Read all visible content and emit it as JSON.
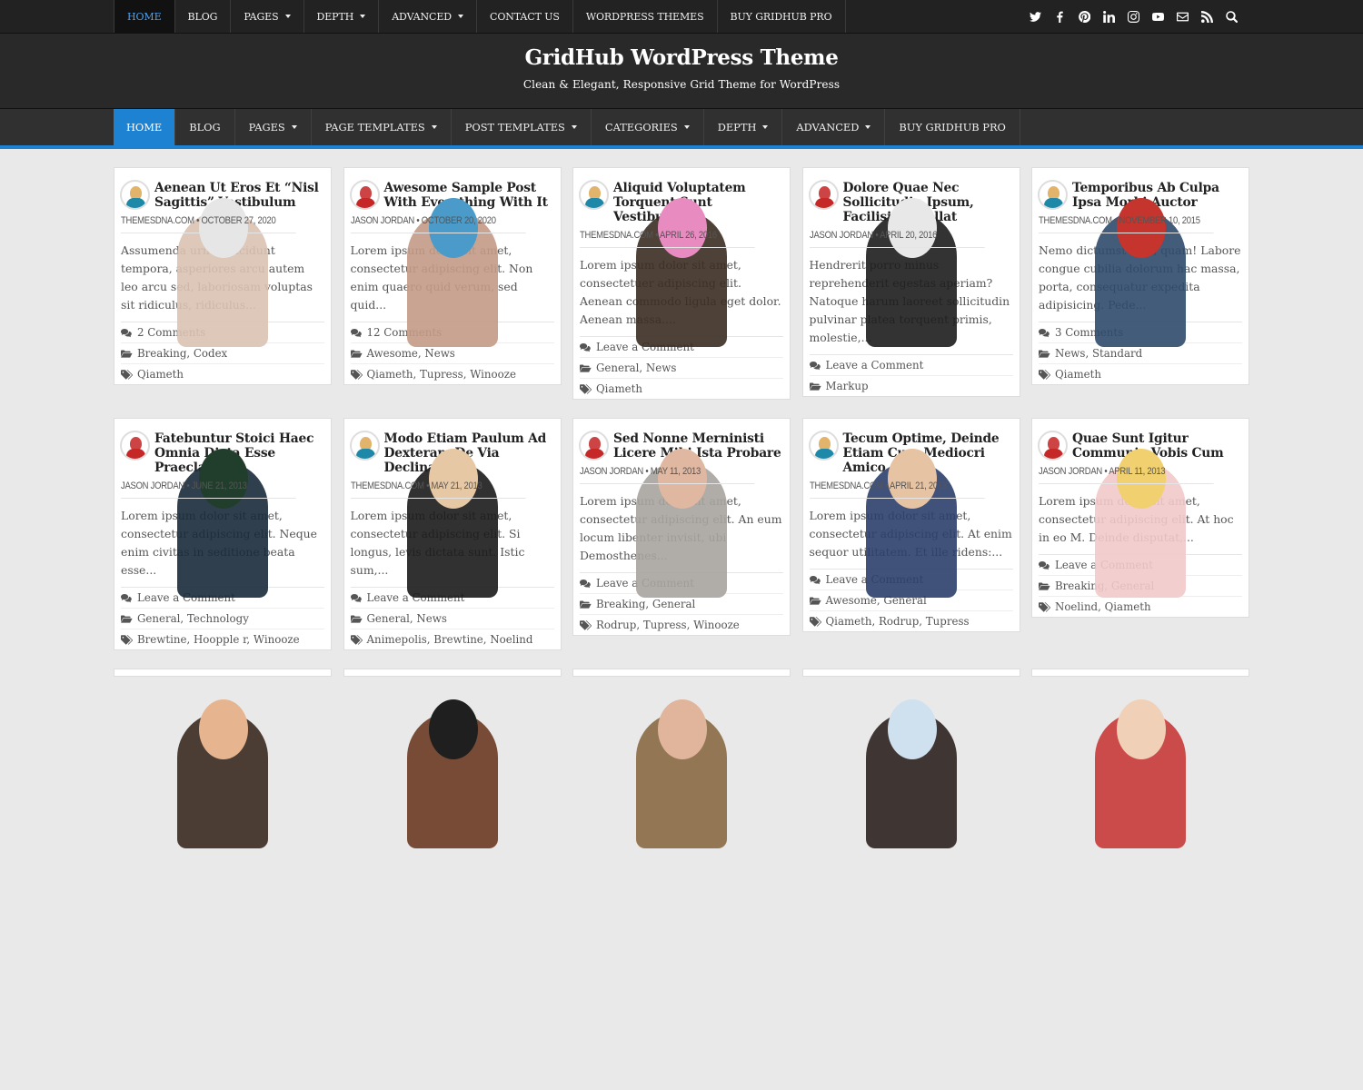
{
  "topnav": {
    "items": [
      {
        "label": "HOME",
        "dropdown": false,
        "active": true
      },
      {
        "label": "BLOG",
        "dropdown": false
      },
      {
        "label": "PAGES",
        "dropdown": true
      },
      {
        "label": "DEPTH",
        "dropdown": true
      },
      {
        "label": "ADVANCED",
        "dropdown": true
      },
      {
        "label": "CONTACT US",
        "dropdown": false
      },
      {
        "label": "WORDPRESS THEMES",
        "dropdown": false
      },
      {
        "label": "BUY GRIDHUB PRO",
        "dropdown": false
      }
    ]
  },
  "social": [
    "twitter-icon",
    "facebook-icon",
    "pinterest-icon",
    "linkedin-icon",
    "instagram-icon",
    "youtube-icon",
    "email-icon",
    "rss-icon",
    "search-icon"
  ],
  "header": {
    "title": "GridHub WordPress Theme",
    "description": "Clean & Elegant, Responsive Grid Theme for WordPress"
  },
  "mainnav": {
    "items": [
      {
        "label": "HOME",
        "dropdown": false,
        "active": true
      },
      {
        "label": "BLOG",
        "dropdown": false
      },
      {
        "label": "PAGES",
        "dropdown": true
      },
      {
        "label": "PAGE TEMPLATES",
        "dropdown": true
      },
      {
        "label": "POST TEMPLATES",
        "dropdown": true
      },
      {
        "label": "CATEGORIES",
        "dropdown": true
      },
      {
        "label": "DEPTH",
        "dropdown": true
      },
      {
        "label": "ADVANCED",
        "dropdown": true
      },
      {
        "label": "BUY GRIDHUB PRO",
        "dropdown": false
      }
    ]
  },
  "colors": {
    "accent": "#1e82d2",
    "topbar": "#222222",
    "header": "#292929",
    "mainnav": "#303030"
  },
  "posts": [
    {
      "title": "Aenean Ut Eros Et “Nisl Sagittis” Vestibulum",
      "author": "THEMESDNA.COM",
      "date": "OCTOBER 27, 2020",
      "excerpt": "Assumenda urna, tincidunt tempora, asperiores arcu autem leo arcu sed, laboriosam voluptas sit ridiculus, ridiculus...",
      "comments": "2 Comments",
      "categories": "Breaking, Codex",
      "tags": "Qiameth",
      "avatar": "yellow",
      "img": {
        "bg": "#3a4a5c",
        "fig": "#d9c2b3",
        "acc": "#e6e6e6"
      }
    },
    {
      "title": "Awesome Sample Post With Everything With It",
      "author": "JASON JORDAN",
      "date": "OCTOBER 20, 2020",
      "excerpt": "Lorem ipsum dolor sit amet, consectetur adipiscing elit. Non enim quaero quid verum, sed quid...",
      "comments": "12 Comments",
      "categories": "Awesome, News",
      "tags": "Qiameth, Tupress, Winooze",
      "avatar": "red",
      "img": {
        "bg": "#1f3b33",
        "fig": "#c49a86",
        "acc": "#4a9bc9"
      }
    },
    {
      "title": "Aliquid Voluptatem Torquent Sunt Vestibulum",
      "author": "THEMESDNA.COM",
      "date": "APRIL 26, 2016",
      "excerpt": "Lorem ipsum dolor sit amet, consectetuer adipiscing elit. Aenean commodo ligula eget dolor. Aenean massa....",
      "comments": "Leave a Comment",
      "categories": "General, News",
      "tags": "Qiameth",
      "avatar": "yellow",
      "img": {
        "bg": "#223d26",
        "fig": "#3b2d22",
        "acc": "#e78bc0"
      }
    },
    {
      "title": "Dolore Quae Nec Sollicitudin Ipsum, Facilisi, Repellat",
      "author": "JASON JORDAN",
      "date": "APRIL 20, 2016",
      "excerpt": "Hendrerit porro minus reprehenderit egestas aperiam? Natoque harum laoreet sollicitudin pulvinar platea torquent primis, molestie,...",
      "comments": "Leave a Comment",
      "categories": "Markup",
      "tags": null,
      "avatar": "red",
      "img": {
        "bg": "#5f6f86",
        "fig": "#1d1d1d",
        "acc": "#e8e8e8"
      }
    },
    {
      "title": "Temporibus Ab Culpa Ipsa Morbi Auctor",
      "author": "THEMESDNA.COM",
      "date": "NOVEMBER 10, 2015",
      "excerpt": "Nemo dictumst quis, quam! Labore congue cubilia dolorum hac massa, porta, consequatur expedita adipisicing. Pede...",
      "comments": "3 Comments",
      "categories": "News, Standard",
      "tags": "Qiameth",
      "avatar": "yellow",
      "img": {
        "bg": "#24402f",
        "fig": "#2e4a6a",
        "acc": "#c5342d"
      }
    },
    {
      "title": "Fatebuntur Stoici Haec Omnia Dicta Esse Praeclare",
      "author": "JASON JORDAN",
      "date": "JUNE 21, 2013",
      "excerpt": "Lorem ipsum dolor sit amet, consectetur adipiscing elit. Neque enim civitas in seditione beata esse...",
      "comments": "Leave a Comment",
      "categories": "General, Technology",
      "tags": "Brewtine, Hoopple r, Winooze",
      "avatar": "red",
      "img": {
        "bg": "#8c8a84",
        "fig": "#1a2a3a",
        "acc": "#213e2c"
      }
    },
    {
      "title": "Modo Etiam Paulum Ad Dexteram De Via Declinavi",
      "author": "THEMESDNA.COM",
      "date": "MAY 21, 2013",
      "excerpt": "Lorem ipsum dolor sit amet, consectetur adipiscing elit. Si longus, levis dictata sunt. Istic sum,...",
      "comments": "Leave a Comment",
      "categories": "General, News",
      "tags": "Animepolis, Brewtine, Noelind",
      "avatar": "yellow",
      "img": {
        "bg": "#e8b6b8",
        "fig": "#1b1b1b",
        "acc": "#e6c8a5"
      }
    },
    {
      "title": "Sed Nonne Merninisti Licere Mihi Ista Probare",
      "author": "JASON JORDAN",
      "date": "MAY 11, 2013",
      "excerpt": "Lorem ipsum dolor sit amet, consectetur adipiscing elit. An eum locum libenter invisit, ubi Demosthenes...",
      "comments": "Leave a Comment",
      "categories": "Breaking, General",
      "tags": "Rodrup, Tupress, Winooze",
      "avatar": "red",
      "img": {
        "bg": "#d9d3cc",
        "fig": "#a7a39d",
        "acc": "#e0b7a0"
      }
    },
    {
      "title": "Tecum Optime, Deinde Etiam Cum Mediocri Amico",
      "author": "THEMESDNA.COM",
      "date": "APRIL 21, 2013",
      "excerpt": "Lorem ipsum dolor sit amet, consectetur adipiscing elit. At enim sequor utilitatem. Et ille ridens:...",
      "comments": "Leave a Comment",
      "categories": "Awesome, General",
      "tags": "Qiameth, Rodrup, Tupress",
      "avatar": "yellow",
      "img": {
        "bg": "#e0478c",
        "fig": "#2b3f6b",
        "acc": "#e6c3a3"
      }
    },
    {
      "title": "Quae Sunt Igitur Communia Vobis Cum",
      "author": "JASON JORDAN",
      "date": "APRIL 11, 2013",
      "excerpt": "Lorem ipsum dolor sit amet, consectetur adipiscing elit. At hoc in eo M. Deinde disputat,...",
      "comments": "Leave a Comment",
      "categories": "Breaking, General",
      "tags": "Noelind, Qiameth",
      "avatar": "red",
      "img": {
        "bg": "#a9d3bf",
        "fig": "#f2c9c9",
        "acc": "#f1d06f"
      }
    },
    {
      "title": "",
      "img": {
        "bg": "#f0b51e",
        "fig": "#3a2a20",
        "acc": "#e6b58f"
      },
      "partial": true
    },
    {
      "title": "",
      "img": {
        "bg": "#d8d2cb",
        "fig": "#6b3a22",
        "acc": "#1f1f1f"
      },
      "partial": true
    },
    {
      "title": "",
      "img": {
        "bg": "#d3c9bd",
        "fig": "#8a6a44",
        "acc": "#e0b59b"
      },
      "partial": true
    },
    {
      "title": "",
      "img": {
        "bg": "#3d86c4",
        "fig": "#2c2220",
        "acc": "#cfe0ee"
      },
      "partial": true
    },
    {
      "title": "",
      "img": {
        "bg": "#f2a1b9",
        "fig": "#c83a3a",
        "acc": "#f0d0b6"
      },
      "partial": true
    }
  ]
}
